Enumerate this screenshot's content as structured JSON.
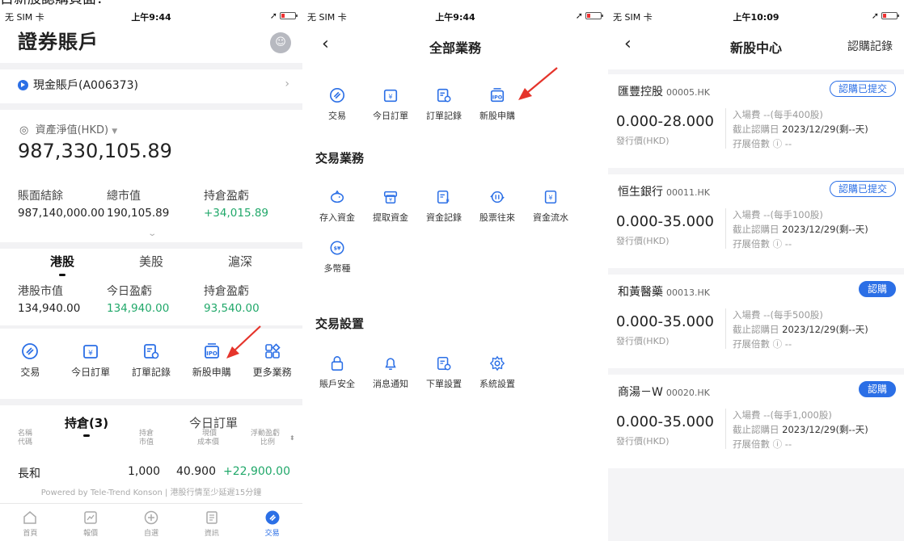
{
  "caption": "目新股認購頁面：",
  "panel1": {
    "status": {
      "carrier": "无 SIM 卡",
      "time": "上午9:44"
    },
    "title": "證券賬戶",
    "account": "現金賬戶(A006373)",
    "nav_label": "資產淨值(HKD)",
    "nav_value": "987,330,105.89",
    "summary": [
      {
        "label": "賬面結餘",
        "value": "987,140,000.00"
      },
      {
        "label": "總市值",
        "value": "190,105.89"
      },
      {
        "label": "持倉盈虧",
        "value": "+34,015.89"
      }
    ],
    "market_tabs": [
      "港股",
      "美股",
      "滬深"
    ],
    "market_summary": [
      {
        "label": "港股市值",
        "value": "134,940.00"
      },
      {
        "label": "今日盈虧",
        "value": "134,940.00"
      },
      {
        "label": "持倉盈虧",
        "value": "93,540.00"
      }
    ],
    "quick_actions": [
      {
        "label": "交易",
        "icon": "trade-icon"
      },
      {
        "label": "今日訂單",
        "icon": "today-order-icon"
      },
      {
        "label": "訂單記錄",
        "icon": "order-record-icon"
      },
      {
        "label": "新股申購",
        "icon": "ipo-icon"
      },
      {
        "label": "更多業務",
        "icon": "more-icon"
      }
    ],
    "position_tabs": [
      "持倉(3)",
      "今日訂單"
    ],
    "position_headers": {
      "c1a": "名稱",
      "c1b": "代碼",
      "c2a": "持倉",
      "c2b": "市值",
      "c3a": "現價",
      "c3b": "成本價",
      "c4a": "浮動盈虧",
      "c4b": "比例"
    },
    "position_row": {
      "name": "長和",
      "qty": "1,000",
      "price": "40.900",
      "pnl": "+22,900.00"
    },
    "powered_by": "Powered by Tele-Trend Konson | 港股行情至少延遲15分鐘",
    "tabbar": [
      "首頁",
      "報價",
      "自選",
      "資訊",
      "交易"
    ]
  },
  "panel2": {
    "status": {
      "carrier": "无 SIM 卡",
      "time": "上午9:44"
    },
    "title": "全部業務",
    "top_actions": [
      "交易",
      "今日訂單",
      "訂單記錄",
      "新股申購"
    ],
    "section_trade": "交易業務",
    "trade_actions": [
      "存入資金",
      "提取資金",
      "資金記錄",
      "股票往來",
      "資金流水",
      "多幣種"
    ],
    "section_settings": "交易設置",
    "settings_actions": [
      "賬戶安全",
      "消息通知",
      "下單設置",
      "系統設置"
    ]
  },
  "panel3": {
    "status": {
      "carrier": "无 SIM 卡",
      "time": "上午10:09"
    },
    "title": "新股中心",
    "link": "認購記錄",
    "price_label": "發行價(HKD)",
    "stocks": [
      {
        "name": "匯豐控股",
        "code": "00005.HK",
        "status": "認購已提交",
        "price": "0.000-28.000",
        "fee": "入場費 --(每手400股)",
        "deadline_label": "截止認購日",
        "deadline": "2023/12/29(剩--天)",
        "multiple": "孖展倍數 ⓘ --"
      },
      {
        "name": "恒生銀行",
        "code": "00011.HK",
        "status": "認購已提交",
        "price": "0.000-35.000",
        "fee": "入場費 --(每手100股)",
        "deadline_label": "截止認購日",
        "deadline": "2023/12/29(剩--天)",
        "multiple": "孖展倍數 ⓘ --"
      },
      {
        "name": "和黃醫藥",
        "code": "00013.HK",
        "status": "認購",
        "price": "0.000-35.000",
        "fee": "入場費 --(每手500股)",
        "deadline_label": "截止認購日",
        "deadline": "2023/12/29(剩--天)",
        "multiple": "孖展倍數 ⓘ --"
      },
      {
        "name": "商湯－W",
        "code": "00020.HK",
        "status": "認購",
        "price": "0.000-35.000",
        "fee": "入場費 --(每手1,000股)",
        "deadline_label": "截止認購日",
        "deadline": "2023/12/29(剩--天)",
        "multiple": "孖展倍數 ⓘ --"
      }
    ]
  },
  "colors": {
    "accent": "#2b6fe6",
    "gain": "#21a86a",
    "arrow": "#e5342b"
  }
}
